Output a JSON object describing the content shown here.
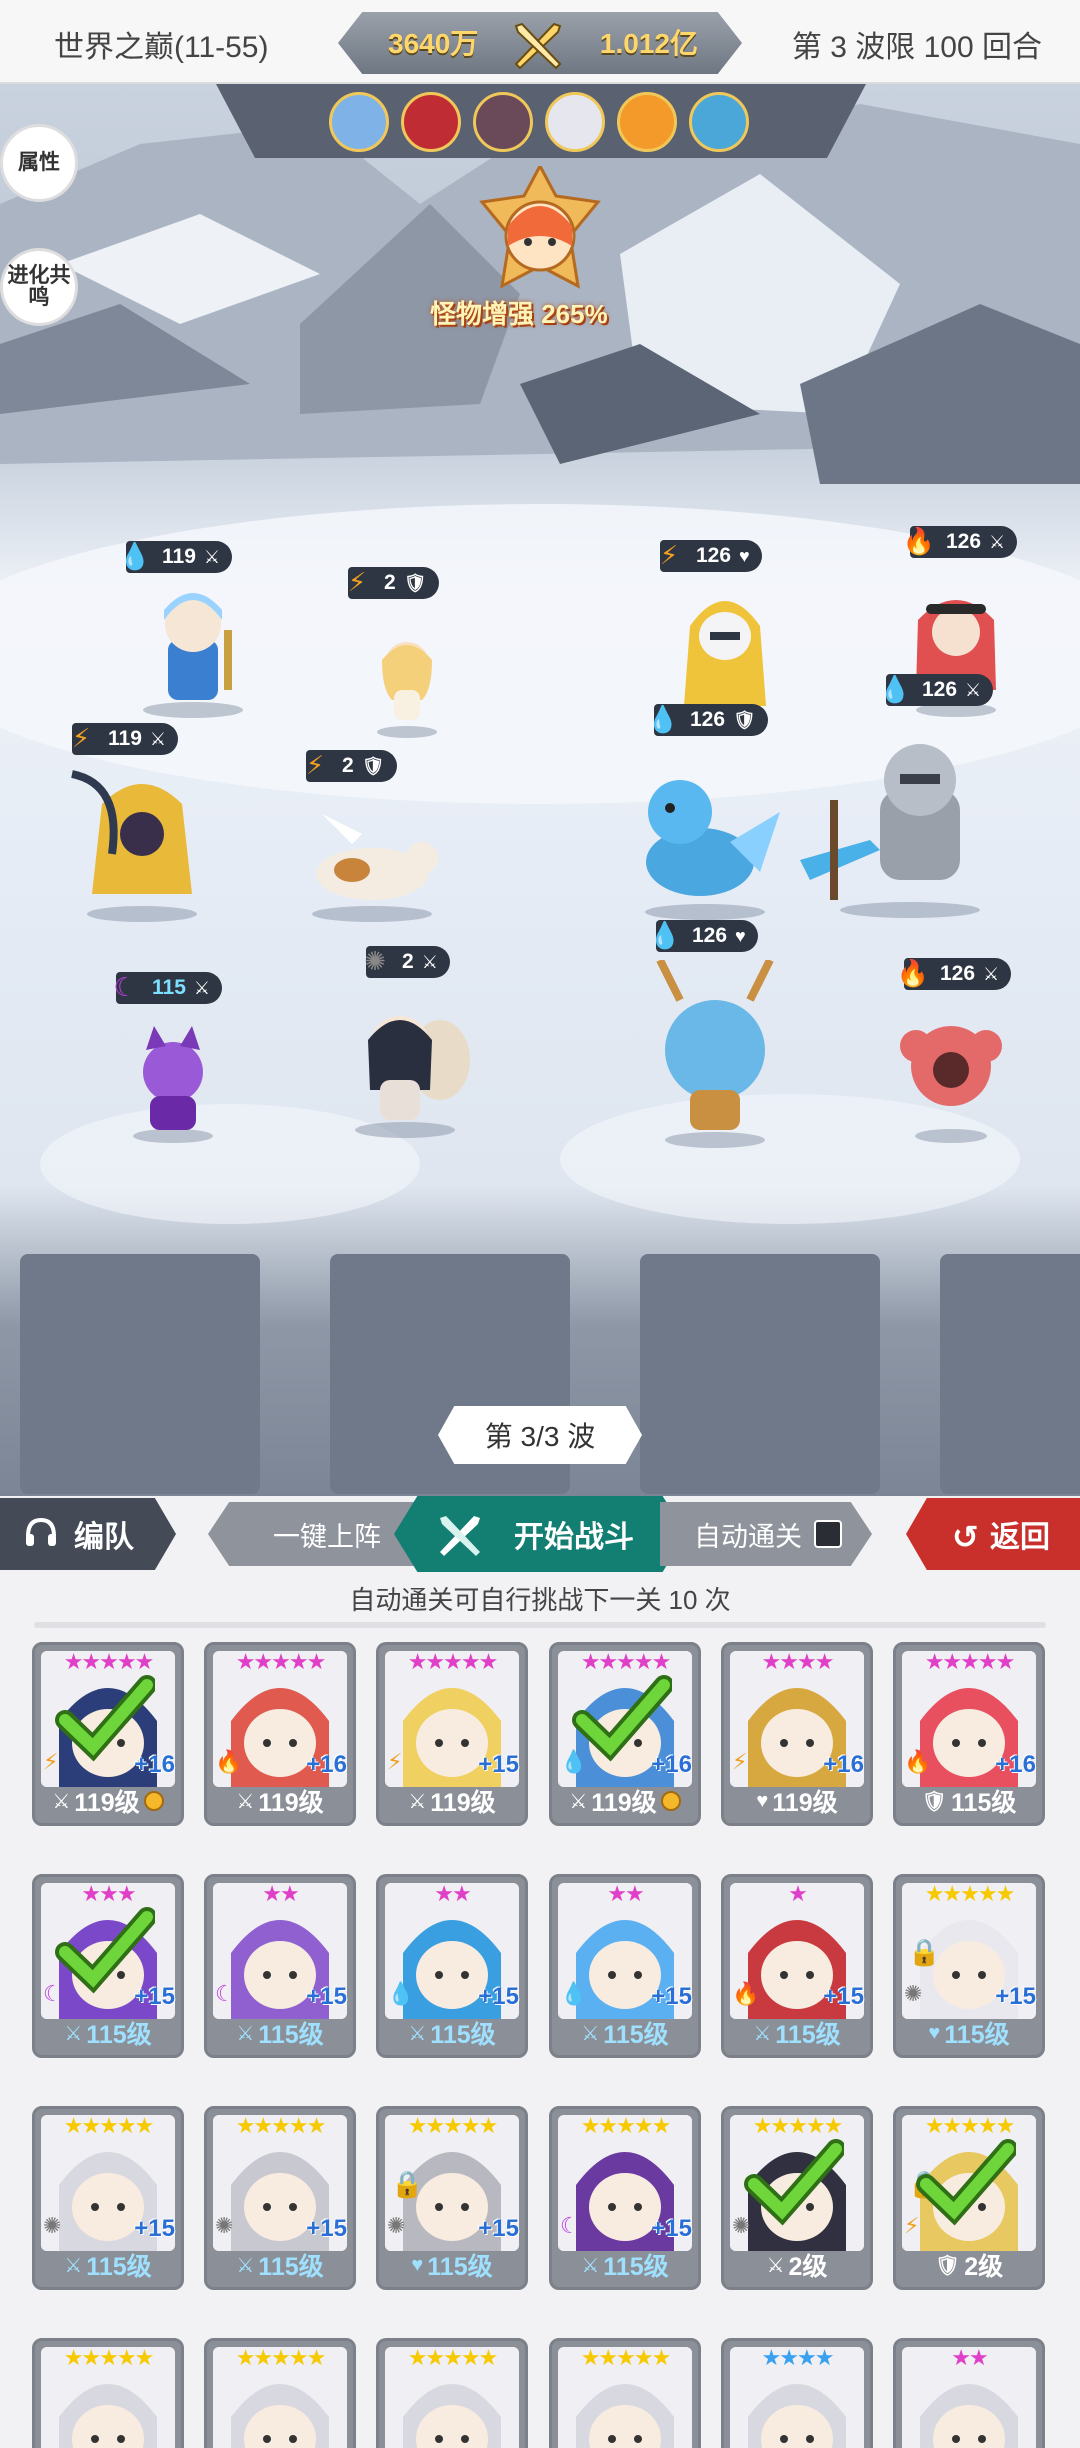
{
  "header": {
    "stage_title": "世界之巅(11-55)",
    "power_left": "3640万",
    "power_right": "1.012亿",
    "wave_limit": "第 3 波限 100 回合"
  },
  "sidebar": {
    "attribute_label": "属性",
    "evolution_label": "进化共鸣"
  },
  "boss": {
    "boost_text": "怪物增强 265%"
  },
  "battle": {
    "wave_indicator": "第 3/3 波",
    "allies": [
      {
        "value": "119",
        "element": "water"
      },
      {
        "value": "2",
        "element": "thunder"
      },
      {
        "value": "119",
        "element": "thunder"
      },
      {
        "value": "2",
        "element": "thunder"
      },
      {
        "value": "115",
        "element": "arcane"
      },
      {
        "value": "2",
        "element": "light"
      }
    ],
    "enemies": [
      {
        "value": "126",
        "element": "thunder"
      },
      {
        "value": "126",
        "element": "fire"
      },
      {
        "value": "126",
        "element": "water"
      },
      {
        "value": "126",
        "element": "water"
      },
      {
        "value": "126",
        "element": "water"
      },
      {
        "value": "126",
        "element": "fire"
      }
    ]
  },
  "actions": {
    "team_label": "编队",
    "quick_deploy_label": "一键上阵",
    "start_battle_label": "开始战斗",
    "auto_clear_label": "自动通关",
    "back_label": "返回"
  },
  "auto_info": "自动通关可自行挑战下一关 10 次",
  "roster": [
    {
      "stars": "★★★★★",
      "star_color": "#e040c8",
      "plus": "+16",
      "element": "thunder",
      "level": "119级",
      "cls": "sword",
      "gold": true,
      "check": true,
      "lock": false,
      "hair": "#2c3e7a"
    },
    {
      "stars": "★★★★★",
      "star_color": "#e040c8",
      "plus": "+16",
      "element": "fire",
      "level": "119级",
      "cls": "sword",
      "gold": false,
      "check": false,
      "lock": false,
      "hair": "#e05a50"
    },
    {
      "stars": "★★★★★",
      "star_color": "#e040c8",
      "plus": "+15",
      "element": "thunder",
      "level": "119级",
      "cls": "sword",
      "gold": false,
      "check": false,
      "lock": false,
      "hair": "#f0d060"
    },
    {
      "stars": "★★★★★",
      "star_color": "#e040c8",
      "plus": "+16",
      "element": "water",
      "level": "119级",
      "cls": "sword",
      "gold": true,
      "check": true,
      "lock": false,
      "hair": "#4a8fd8"
    },
    {
      "stars": "★★★★",
      "star_color": "#e040c8",
      "plus": "+16",
      "element": "thunder",
      "level": "119级",
      "cls": "heart",
      "gold": false,
      "check": false,
      "lock": false,
      "hair": "#d8a840"
    },
    {
      "stars": "★★★★★",
      "star_color": "#e040c8",
      "plus": "+16",
      "element": "fire",
      "level": "115级",
      "cls": "shield",
      "gold": false,
      "check": false,
      "lock": false,
      "hair": "#e85060"
    },
    {
      "stars": "★★★",
      "star_color": "#e040c8",
      "plus": "+15",
      "element": "arcane",
      "level": "115级",
      "cls": "sword",
      "gold": false,
      "check": true,
      "lock": false,
      "hair": "#7a48c8",
      "blue": true
    },
    {
      "stars": "★★",
      "star_color": "#e040c8",
      "plus": "+15",
      "element": "arcane",
      "level": "115级",
      "cls": "sword",
      "gold": false,
      "check": false,
      "lock": false,
      "hair": "#9060d0",
      "blue": true
    },
    {
      "stars": "★★",
      "star_color": "#e040c8",
      "plus": "+15",
      "element": "water",
      "level": "115级",
      "cls": "sword",
      "gold": false,
      "check": false,
      "lock": false,
      "hair": "#3a9fe0",
      "blue": true
    },
    {
      "stars": "★★",
      "star_color": "#e040c8",
      "plus": "+15",
      "element": "water",
      "level": "115级",
      "cls": "sword",
      "gold": false,
      "check": false,
      "lock": false,
      "hair": "#5ab0f0",
      "blue": true
    },
    {
      "stars": "★",
      "star_color": "#e040c8",
      "plus": "+15",
      "element": "fire",
      "level": "115级",
      "cls": "sword",
      "gold": false,
      "check": false,
      "lock": false,
      "hair": "#c83a40",
      "blue": true
    },
    {
      "stars": "★★★★★",
      "star_color": "#f6c900",
      "plus": "+15",
      "element": "light",
      "level": "115级",
      "cls": "heart",
      "gold": false,
      "check": false,
      "lock": true,
      "hair": "#e8e8ee",
      "blue": true
    },
    {
      "stars": "★★★★★",
      "star_color": "#f6c900",
      "plus": "+15",
      "element": "light",
      "level": "115级",
      "cls": "sword",
      "gold": false,
      "check": false,
      "lock": false,
      "hair": "#d8d8e0",
      "blue": true
    },
    {
      "stars": "★★★★★",
      "star_color": "#f6c900",
      "plus": "+15",
      "element": "light",
      "level": "115级",
      "cls": "sword",
      "gold": false,
      "check": false,
      "lock": false,
      "hair": "#c8c8d0",
      "blue": true
    },
    {
      "stars": "★★★★★",
      "star_color": "#f6c900",
      "plus": "+15",
      "element": "light",
      "level": "115级",
      "cls": "heart",
      "gold": false,
      "check": false,
      "lock": true,
      "hair": "#b8b8c0",
      "blue": true
    },
    {
      "stars": "★★★★★",
      "star_color": "#f6c900",
      "plus": "+15",
      "element": "arcane",
      "level": "115级",
      "cls": "sword",
      "gold": false,
      "check": false,
      "lock": false,
      "hair": "#6a3aa0",
      "blue": true
    },
    {
      "stars": "★★★★★",
      "star_color": "#f6c900",
      "plus": "",
      "element": "light",
      "level": "2级",
      "cls": "sword",
      "gold": false,
      "check": true,
      "lock": false,
      "hair": "#303040"
    },
    {
      "stars": "★★★★★",
      "star_color": "#f6c900",
      "plus": "",
      "element": "thunder",
      "level": "2级",
      "cls": "shield",
      "gold": false,
      "check": true,
      "lock": true,
      "hair": "#e8c860"
    },
    {
      "stars": "★★★★★",
      "star_color": "#f6c900",
      "partial": true
    },
    {
      "stars": "★★★★★",
      "star_color": "#f6c900",
      "partial": true
    },
    {
      "stars": "★★★★★",
      "star_color": "#f6c900",
      "partial": true
    },
    {
      "stars": "★★★★★",
      "star_color": "#f6c900",
      "partial": true
    },
    {
      "stars": "★★★★",
      "star_color": "#3aa0f0",
      "partial": true
    },
    {
      "stars": "★★",
      "star_color": "#e040c8",
      "partial": true
    }
  ]
}
